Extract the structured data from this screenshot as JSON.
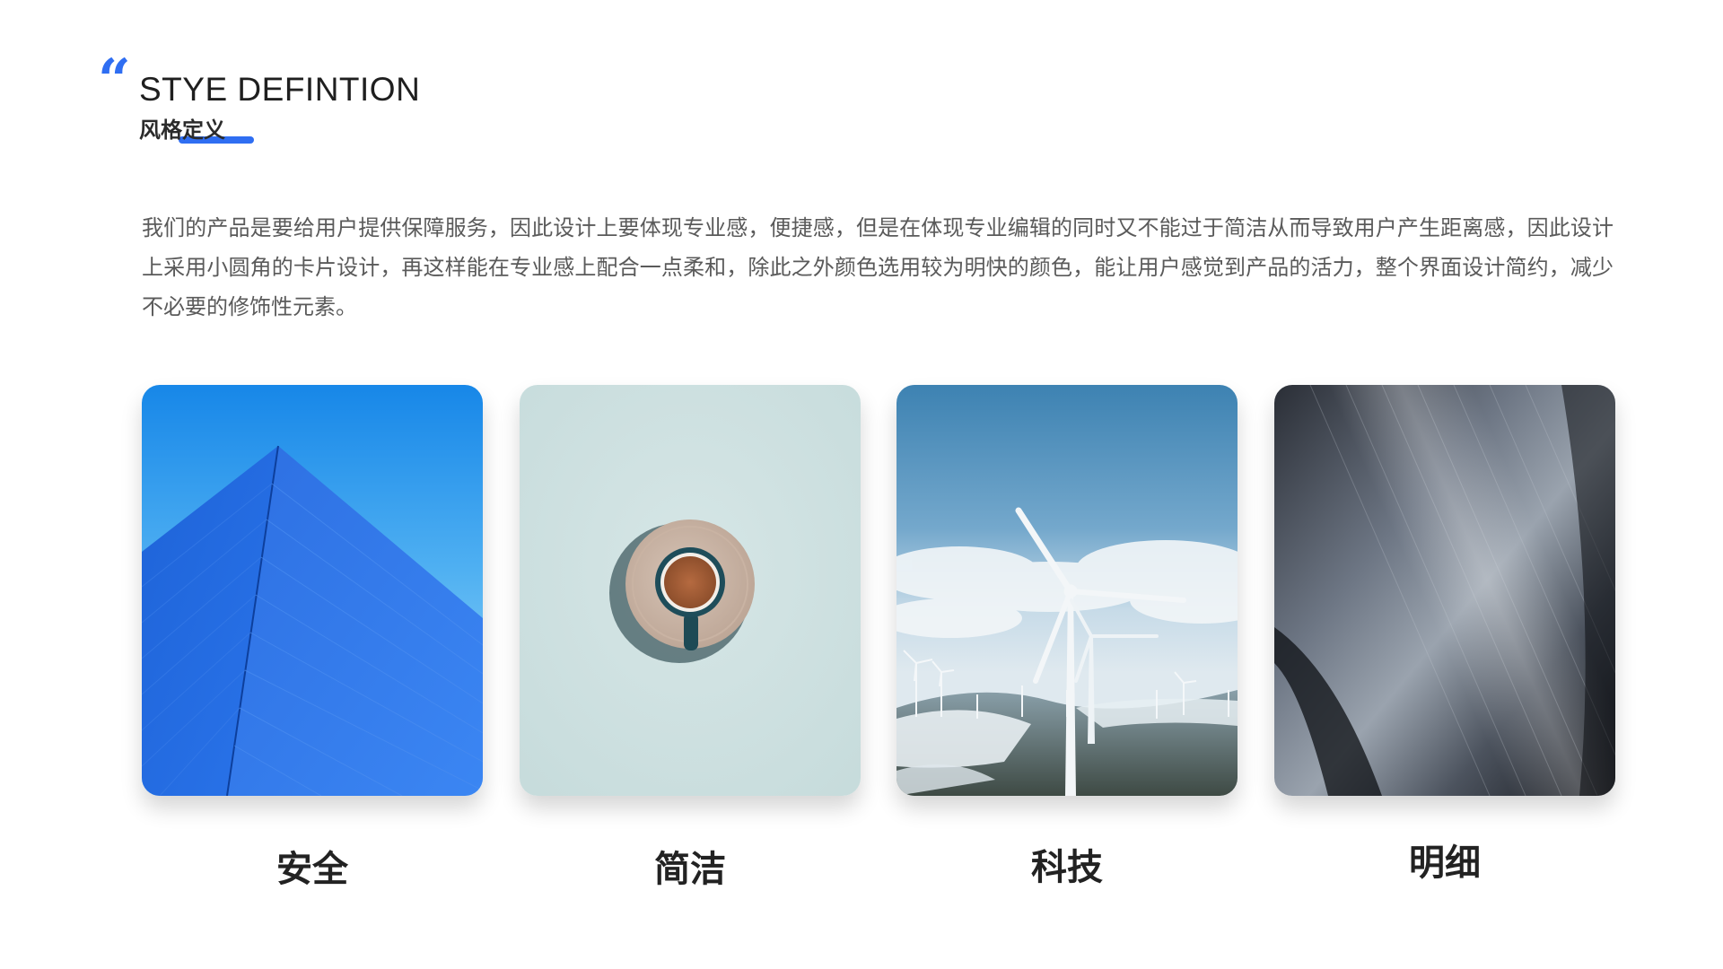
{
  "header": {
    "quote_mark": "“",
    "title_en": "STYE DEFINTION",
    "title_cn": "风格定义",
    "accent_color": "#2f6ef2"
  },
  "description": "我们的产品是要给用户提供保障服务，因此设计上要体现专业感，便捷感，但是在体现专业编辑的同时又不能过于简洁从而导致用户产生距离感，因此设计上采用小圆角的卡片设计，再这样能在专业感上配合一点柔和，除此之外颜色选用较为明快的颜色，能让用户感觉到产品的活力，整个界面设计简约，减少不必要的修饰性元素。",
  "cards": [
    {
      "label": "安全",
      "image": "blue-building-image"
    },
    {
      "label": "简洁",
      "image": "coffee-cup-image"
    },
    {
      "label": "科技",
      "image": "wind-turbines-image"
    },
    {
      "label": "明细",
      "image": "dark-texture-image"
    }
  ]
}
